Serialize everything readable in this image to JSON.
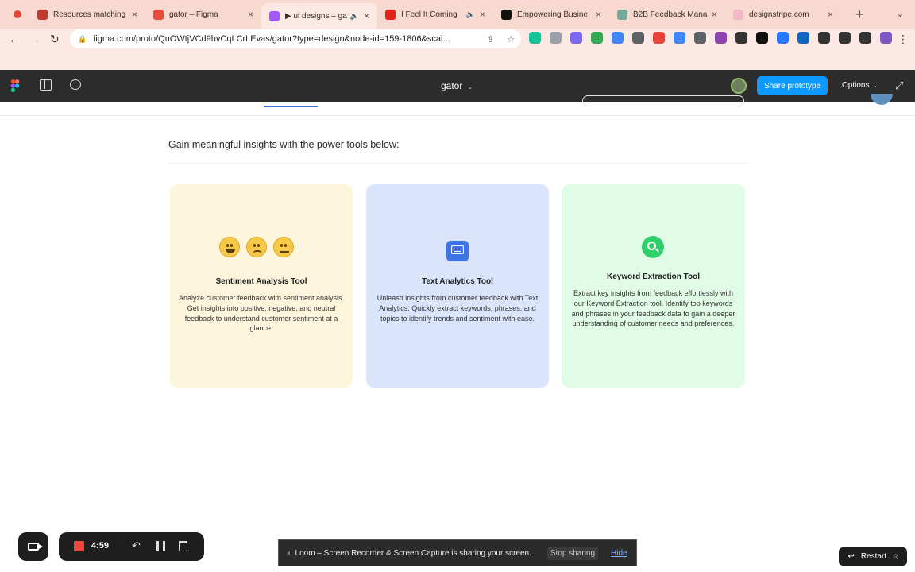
{
  "browser": {
    "tabs": [
      {
        "title": "Resources matching",
        "icon_color": "#c0392b",
        "active": false
      },
      {
        "title": "gator – Figma",
        "icon_color": "#e74c3c",
        "active": false
      },
      {
        "title": "▶ ui designs – ga",
        "icon_color": "#a259ff",
        "active": true
      },
      {
        "title": "I Feel It Coming",
        "icon_color": "#e62117",
        "active": false
      },
      {
        "title": "Empowering Busine",
        "icon_color": "#111111",
        "active": false
      },
      {
        "title": "B2B Feedback Mana",
        "icon_color": "#74aa9c",
        "active": false
      },
      {
        "title": "designstripe.com",
        "icon_color": "#f2b8c6",
        "active": false
      }
    ],
    "url": "figma.com/proto/QuOWtjVCd9hvCqLCrLEvas/gator?type=design&node-id=159-1806&scal...",
    "extensions": [
      {
        "name": "grammarly-icon",
        "color": "#15c39a"
      },
      {
        "name": "camera-icon",
        "color": "#9aa0a6"
      },
      {
        "name": "pen-icon",
        "color": "#7b68ee"
      },
      {
        "name": "chart-icon",
        "color": "#34a853"
      },
      {
        "name": "grid-icon",
        "color": "#4285f4"
      },
      {
        "name": "gear-icon",
        "color": "#5f6368"
      },
      {
        "name": "shield-icon",
        "color": "#e8453c"
      },
      {
        "name": "translate-icon",
        "color": "#4285f4"
      },
      {
        "name": "image-icon",
        "color": "#5f6368"
      },
      {
        "name": "circle-icon",
        "color": "#8e44ad"
      },
      {
        "name": "function-icon",
        "color": "#333333"
      },
      {
        "name": "s-icon",
        "color": "#111111"
      },
      {
        "name": "ring-icon",
        "color": "#2979ff"
      },
      {
        "name": "x-tool-icon",
        "color": "#1565c0"
      },
      {
        "name": "puzzle-icon",
        "color": "#333333"
      },
      {
        "name": "list-icon",
        "color": "#333333"
      },
      {
        "name": "sidebar-icon",
        "color": "#333333"
      },
      {
        "name": "profile-icon",
        "color": "#7e57c2"
      }
    ]
  },
  "figma": {
    "file_name": "gator",
    "share_label": "Share prototype",
    "options_label": "Options"
  },
  "page": {
    "heading": "Gain meaningful insights with the power tools below:",
    "cards": [
      {
        "title": "Sentiment Analysis Tool",
        "description": "Analyze customer feedback with sentiment analysis. Get insights into positive, negative, and neutral feedback to understand customer sentiment at a glance.",
        "color": "#fdf6dc"
      },
      {
        "title": "Text Analytics Tool",
        "description": "Unleash insights from customer feedback with Text Analytics. Quickly extract keywords, phrases, and topics to identify trends and sentiment with ease.",
        "color": "#dae4fb"
      },
      {
        "title": "Keyword Extraction Tool",
        "description": "Extract key insights from feedback effortlessly with our Keyword Extraction tool. Identify top keywords and phrases in your feedback data to gain a deeper understanding of customer needs and preferences.",
        "color": "#e0fbe6"
      }
    ]
  },
  "loom": {
    "timer": "4:59",
    "share_message": "Loom – Screen Recorder & Screen Capture is sharing your screen.",
    "stop_label": "Stop sharing",
    "hide_label": "Hide"
  },
  "restart": {
    "label": "Restart",
    "shortcut": "R"
  }
}
